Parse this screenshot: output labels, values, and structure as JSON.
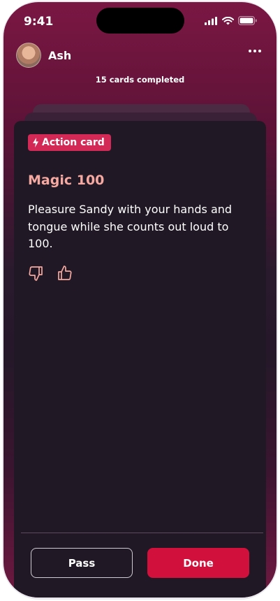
{
  "status_bar": {
    "time": "9:41"
  },
  "header": {
    "user_name": "Ash"
  },
  "progress": {
    "text": "15 cards completed"
  },
  "card": {
    "badge_label": "Action card",
    "title": "Magic 100",
    "body": "Pleasure Sandy with your hands and tongue while she counts out loud to 100."
  },
  "actions": {
    "pass_label": "Pass",
    "done_label": "Done"
  },
  "colors": {
    "accent": "#d2103c",
    "badge": "#d22956",
    "title": "#f5a9a1",
    "card_bg": "#201825"
  },
  "icons": [
    "lightning-icon",
    "thumbs-down-icon",
    "thumbs-up-icon",
    "more-icon"
  ]
}
